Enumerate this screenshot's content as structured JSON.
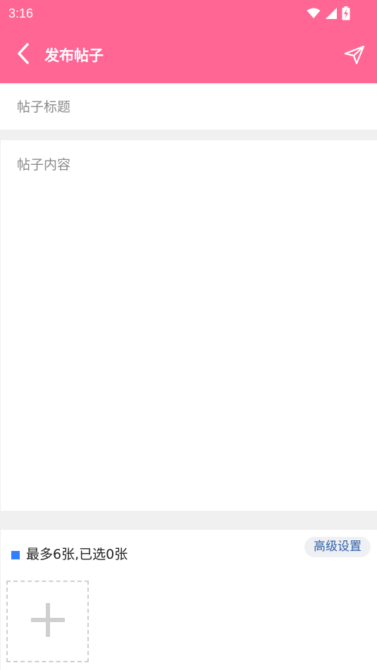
{
  "status_bar": {
    "time": "3:16",
    "icons": [
      "wifi-icon",
      "signal-icon",
      "battery-charging-icon"
    ]
  },
  "app_bar": {
    "title": "发布帖子",
    "back_icon": "chevron-left-icon",
    "send_icon": "send-icon",
    "background_color": "#ff6694"
  },
  "post_form": {
    "title_placeholder": "帖子标题",
    "title_value": "",
    "content_placeholder": "帖子内容",
    "content_value": ""
  },
  "images": {
    "count_text": "最多6张,已选0张",
    "advanced_settings_label": "高级设置",
    "indicator_color": "#2f7fff",
    "add_icon": "plus-icon"
  }
}
